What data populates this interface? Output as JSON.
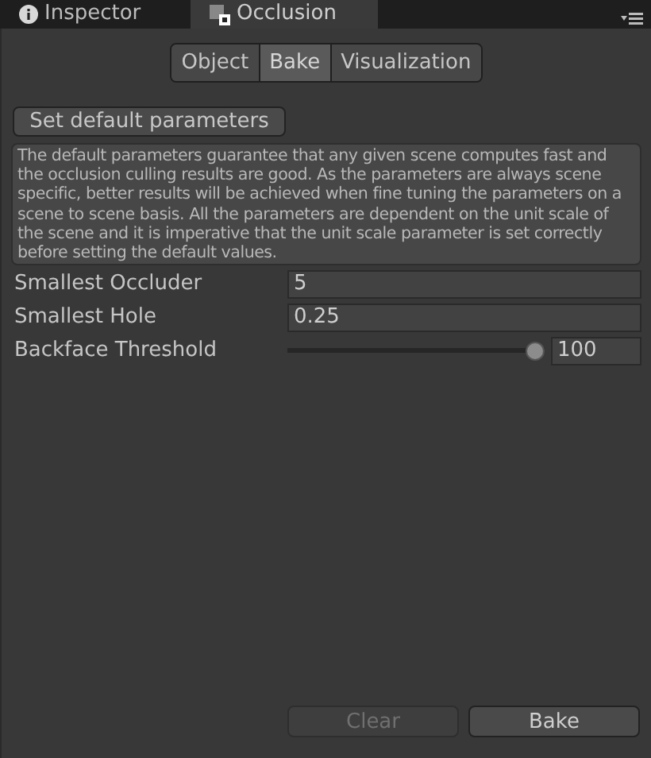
{
  "window_tabs": [
    {
      "label": "Inspector",
      "kind": "info",
      "selected": false
    },
    {
      "label": "Occlusion",
      "kind": "occlusion",
      "selected": true
    }
  ],
  "mode_tabs": [
    {
      "label": "Object",
      "selected": false
    },
    {
      "label": "Bake",
      "selected": true
    },
    {
      "label": "Visualization",
      "selected": false
    }
  ],
  "set_default_button": "Set default parameters",
  "help_text": "The default parameters guarantee that any given scene computes fast and the occlusion culling results are good. As the parameters are always scene specific, better results will be achieved when fine tuning the parameters on a scene to scene basis. All the parameters are dependent on the unit scale of the scene and it is imperative that the unit scale parameter is set correctly before setting the default values.",
  "fields": [
    {
      "kind": "number",
      "label": "Smallest Occluder",
      "value": "5"
    },
    {
      "kind": "number",
      "label": "Smallest Hole",
      "value": "0.25"
    },
    {
      "kind": "slider",
      "label": "Backface Threshold",
      "value": "100",
      "level": 1
    }
  ],
  "buttons": [
    {
      "label": "Clear",
      "disabled": true
    },
    {
      "label": "Bake",
      "disabled": false
    }
  ]
}
